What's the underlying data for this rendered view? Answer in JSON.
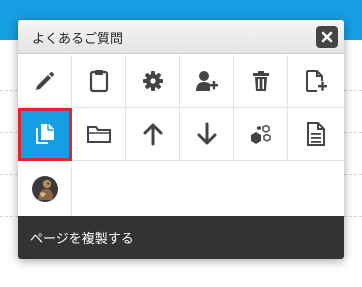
{
  "modal": {
    "title": "よくあるご質問",
    "close_icon": "close-icon"
  },
  "toolbar": {
    "items": [
      {
        "icon": "pencil-icon",
        "row": 1,
        "col": 1
      },
      {
        "icon": "clipboard-icon",
        "row": 1,
        "col": 2
      },
      {
        "icon": "gear-icon",
        "row": 1,
        "col": 3
      },
      {
        "icon": "add-user-icon",
        "row": 1,
        "col": 4
      },
      {
        "icon": "trash-icon",
        "row": 1,
        "col": 5
      },
      {
        "icon": "new-page-icon",
        "row": 1,
        "col": 6
      },
      {
        "icon": "copy-page-icon",
        "row": 2,
        "col": 1,
        "selected": true
      },
      {
        "icon": "folder-icon",
        "row": 2,
        "col": 2
      },
      {
        "icon": "arrow-up-icon",
        "row": 2,
        "col": 3
      },
      {
        "icon": "arrow-down-icon",
        "row": 2,
        "col": 4
      },
      {
        "icon": "cubes-icon",
        "row": 2,
        "col": 5
      },
      {
        "icon": "document-icon",
        "row": 2,
        "col": 6
      },
      {
        "icon": "avatar-icon",
        "row": 3,
        "col": 1
      }
    ]
  },
  "tooltip": {
    "text": "ページを複製する"
  },
  "colors": {
    "accent": "#169ee3",
    "selection_outline": "#e0262a",
    "tooltip_bg": "#333333",
    "icon": "#444444"
  }
}
